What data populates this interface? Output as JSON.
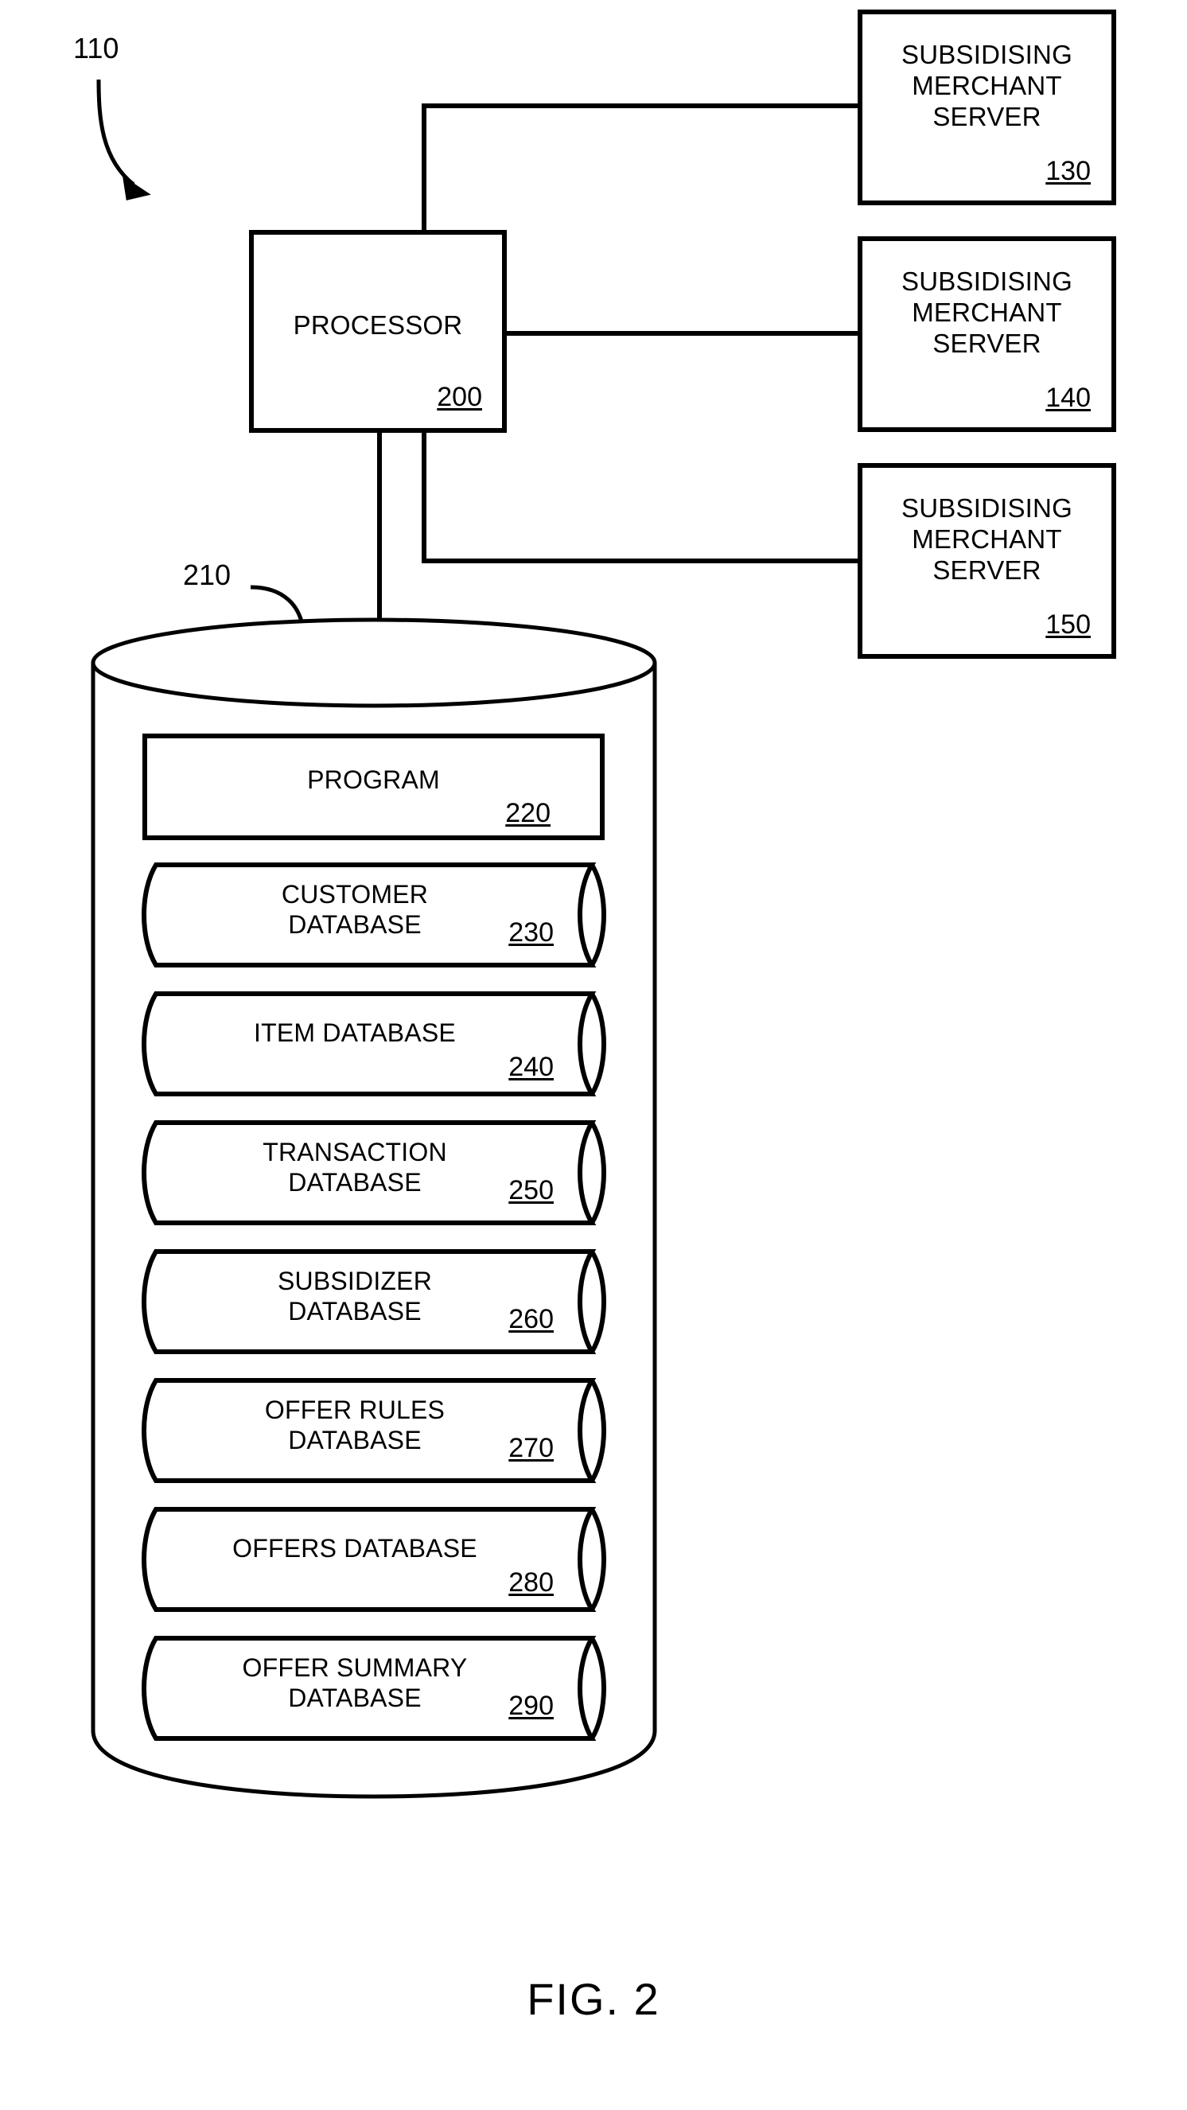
{
  "figure": {
    "caption": "FIG. 2",
    "system_ref": "110",
    "datastore_ref": "210"
  },
  "processor": {
    "label": "PROCESSOR",
    "ref": "200"
  },
  "servers": [
    {
      "label": "SUBSIDISING\nMERCHANT\nSERVER",
      "ref": "130"
    },
    {
      "label": "SUBSIDISING\nMERCHANT\nSERVER",
      "ref": "140"
    },
    {
      "label": "SUBSIDISING\nMERCHANT\nSERVER",
      "ref": "150"
    }
  ],
  "datastore": {
    "program": {
      "label": "PROGRAM",
      "ref": "220"
    },
    "databases": [
      {
        "label": "CUSTOMER\nDATABASE",
        "ref": "230",
        "lines": 2
      },
      {
        "label": "ITEM DATABASE",
        "ref": "240",
        "lines": 1
      },
      {
        "label": "TRANSACTION\nDATABASE",
        "ref": "250",
        "lines": 2
      },
      {
        "label": "SUBSIDIZER\nDATABASE",
        "ref": "260",
        "lines": 2
      },
      {
        "label": "OFFER RULES\nDATABASE",
        "ref": "270",
        "lines": 2
      },
      {
        "label": "OFFERS DATABASE",
        "ref": "280",
        "lines": 1
      },
      {
        "label": "OFFER SUMMARY\nDATABASE",
        "ref": "290",
        "lines": 2
      }
    ]
  },
  "colors": {
    "ink": "#000000",
    "paper": "#ffffff"
  }
}
